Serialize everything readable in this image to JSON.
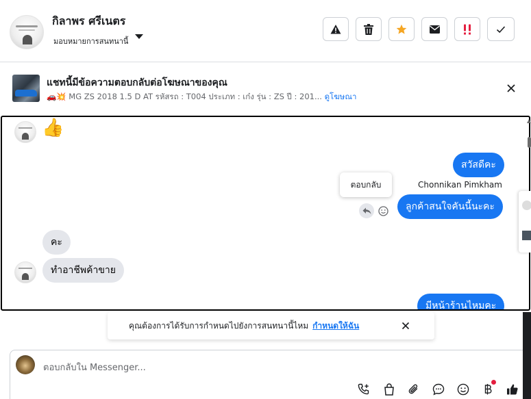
{
  "contact": {
    "name": "กิลาพร ศรีเนตร",
    "assignment_label": "มอบหมายการสนทนานี้"
  },
  "header_actions": [
    {
      "name": "alert",
      "icon": "warning-icon"
    },
    {
      "name": "delete",
      "icon": "trash-icon"
    },
    {
      "name": "star",
      "icon": "star-icon",
      "color": "#f5a623"
    },
    {
      "name": "mail",
      "icon": "envelope-icon"
    },
    {
      "name": "important",
      "icon": "exclamation-icon",
      "color": "#e41e3f"
    },
    {
      "name": "done",
      "icon": "check-icon"
    }
  ],
  "ad_reply": {
    "title": "แชทนี้มีข้อความตอบกลับต่อโฆษณาของคุณ",
    "details": "🚗💥 MG ZS 2018 1.5 D AT รหัสรถ : T004 ประเภท : เก๋ง รุ่น : ZS ปี : 201...",
    "link_label": "ดูโฆษณา"
  },
  "messages": {
    "thumbs_up": "👍",
    "out_1": "สวัสดีคะ",
    "sender_name": "Chonnikan Pimkham",
    "out_2": "ลูกค้าสนใจคันนี้นะคะ",
    "in_1": "คะ",
    "in_2": "ทำอาชีพค้าขาย",
    "out_3": "มีหน้าร้านไหมคะ"
  },
  "tooltip": {
    "label": "ตอบกลับ"
  },
  "assign_banner": {
    "text": "คุณต้องการได้รับการกำหนดไปยังการสนทนานี้ไหม",
    "link_label": "กำหนดให้ฉัน"
  },
  "composer": {
    "placeholder": "ตอบกลับใน Messenger..."
  },
  "composer_tools": [
    "phone-add-icon",
    "shopping-bag-icon",
    "attachment-icon",
    "chat-bubble-icon",
    "emoji-icon",
    "baht-icon",
    "thumbs-up-icon"
  ],
  "colors": {
    "accent": "#1877f2",
    "incoming_bubble": "#e4e6eb",
    "star": "#f5a623",
    "danger": "#e41e3f"
  }
}
